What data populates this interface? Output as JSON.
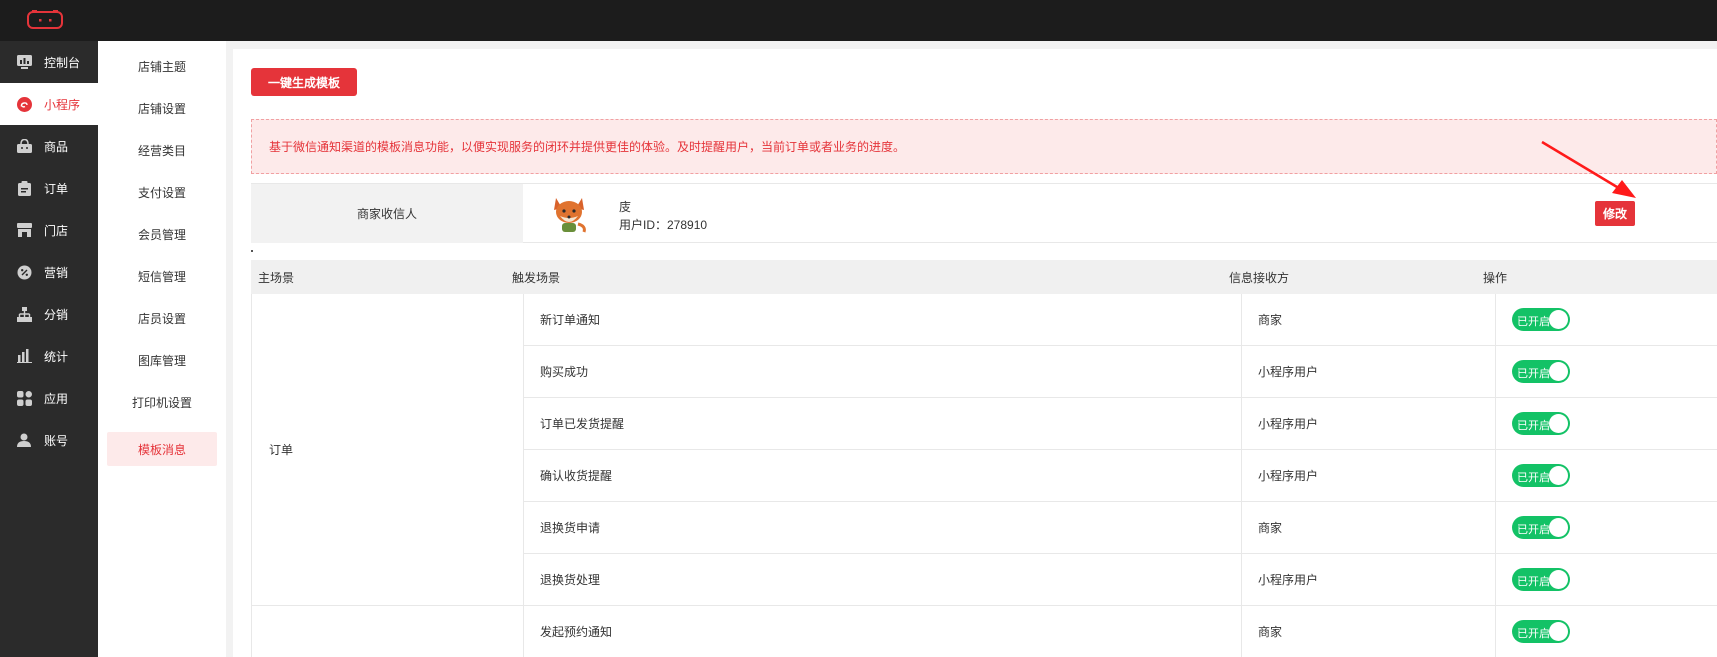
{
  "sidebar": {
    "items": [
      {
        "label": "控制台",
        "icon": "dashboard-icon"
      },
      {
        "label": "小程序",
        "icon": "mini-program-icon",
        "active": true
      },
      {
        "label": "商品",
        "icon": "shopping-bag-icon"
      },
      {
        "label": "订单",
        "icon": "order-clipboard-icon"
      },
      {
        "label": "门店",
        "icon": "store-icon"
      },
      {
        "label": "营销",
        "icon": "marketing-gear-icon"
      },
      {
        "label": "分销",
        "icon": "distribution-tree-icon"
      },
      {
        "label": "统计",
        "icon": "bar-chart-icon"
      },
      {
        "label": "应用",
        "icon": "apps-grid-icon"
      },
      {
        "label": "账号",
        "icon": "user-icon"
      }
    ]
  },
  "subnav": {
    "items": [
      {
        "label": "店铺主题"
      },
      {
        "label": "店铺设置"
      },
      {
        "label": "经营类目"
      },
      {
        "label": "支付设置"
      },
      {
        "label": "会员管理"
      },
      {
        "label": "短信管理"
      },
      {
        "label": "店员设置"
      },
      {
        "label": "图库管理"
      },
      {
        "label": "打印机设置"
      },
      {
        "label": "模板消息",
        "active": true
      }
    ]
  },
  "main": {
    "generate_button": "一键生成模板",
    "notice": "基于微信通知渠道的模板消息功能，以便实现服务的闭环并提供更佳的体验。及时提醒用户，当前订单或者业务的进度。",
    "receiver": {
      "label": "商家收信人",
      "name": "庋",
      "user_id": "用户ID：278910",
      "edit_button": "修改"
    },
    "table": {
      "headers": {
        "main_scene": "主场景",
        "trigger_scene": "触发场景",
        "receiver": "信息接收方",
        "action": "操作"
      },
      "groups": [
        {
          "name": "订单"
        },
        {
          "name": ""
        }
      ],
      "rows": [
        {
          "scene": "新订单通知",
          "receiver": "商家",
          "status": "已开启"
        },
        {
          "scene": "购买成功",
          "receiver": "小程序用户",
          "status": "已开启"
        },
        {
          "scene": "订单已发货提醒",
          "receiver": "小程序用户",
          "status": "已开启"
        },
        {
          "scene": "确认收货提醒",
          "receiver": "小程序用户",
          "status": "已开启"
        },
        {
          "scene": "退换货申请",
          "receiver": "商家",
          "status": "已开启"
        },
        {
          "scene": "退换货处理",
          "receiver": "小程序用户",
          "status": "已开启"
        },
        {
          "scene": "发起预约通知",
          "receiver": "商家",
          "status": "已开启"
        }
      ]
    }
  },
  "colors": {
    "accent": "#e5343a",
    "toggle_on": "#13c266",
    "sidebar_bg": "#2b2b2b",
    "topbar_bg": "#1c1c1c"
  }
}
